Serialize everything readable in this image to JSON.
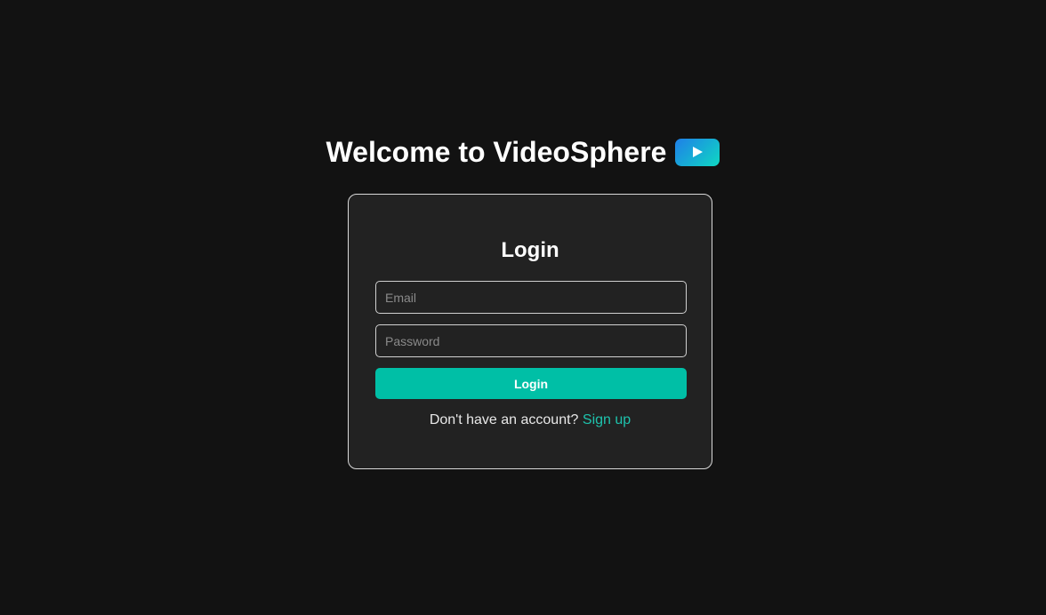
{
  "header": {
    "title": "Welcome to VideoSphere",
    "icon": "play-logo-icon",
    "icon_gradient": [
      "#1f7fe8",
      "#0fd8c3"
    ]
  },
  "login_form": {
    "title": "Login",
    "email": {
      "placeholder": "Email",
      "value": ""
    },
    "password": {
      "placeholder": "Password",
      "value": ""
    },
    "submit_label": "Login",
    "signup_prompt": "Don't have an account?",
    "signup_link": "Sign up"
  },
  "colors": {
    "background": "#121212",
    "card": "#222222",
    "accent": "#00bfa6",
    "link": "#1ec3ad"
  }
}
